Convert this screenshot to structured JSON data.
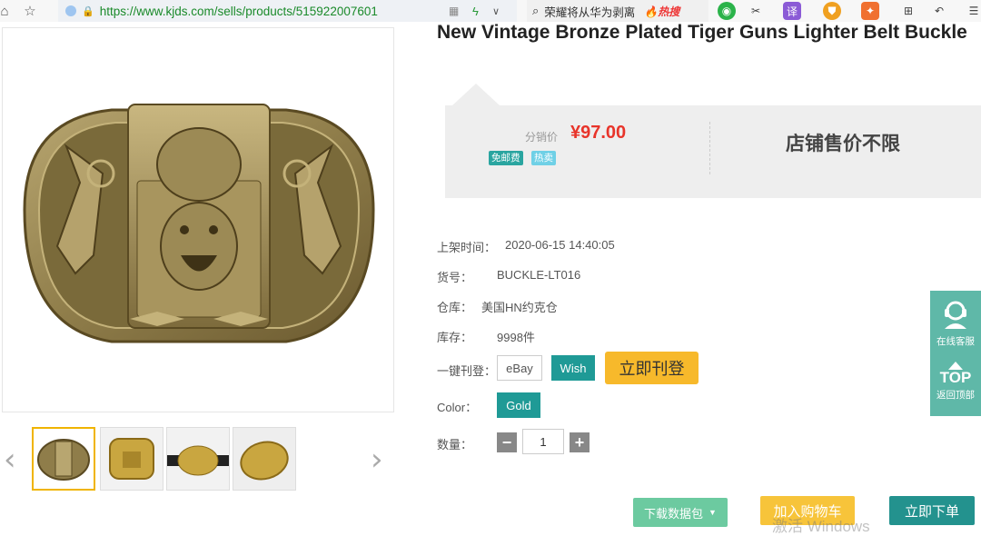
{
  "browser": {
    "url": "https://www.kjds.com/sells/products/515922007601",
    "search_text": "荣耀将从华为剥离",
    "search_hot": "🔥热搜"
  },
  "product": {
    "title": "New Vintage Bronze Plated Tiger Guns Lighter Belt Buckle",
    "price_label": "分销价",
    "price": "¥97.00",
    "badge_free": "免邮费",
    "badge_hot": "热卖",
    "store_price": "店铺售价不限"
  },
  "info": {
    "listed_label": "上架时间：",
    "listed_value": "2020-06-15 14:40:05",
    "sku_label": "货号：",
    "sku_value": "BUCKLE-LT016",
    "warehouse_label": "仓库：",
    "warehouse_value": "美国HN约克仓",
    "stock_label": "库存：",
    "stock_value": "9998件",
    "publish_label": "一键刊登：",
    "color_label": "Color：",
    "qty_label": "数量："
  },
  "buttons": {
    "ebay": "eBay",
    "wish": "Wish",
    "publish_now": "立即刊登",
    "gold": "Gold",
    "qty_minus": "−",
    "qty_plus": "+",
    "qty_value": "1",
    "download": "下载数据包",
    "add_cart": "加入购物车",
    "buy_now": "立即下单"
  },
  "side": {
    "cs_label": "在线客服",
    "top_label": "TOP",
    "top_sub": "返回顶部"
  },
  "watermark": "激活 Windows",
  "colors": {
    "teal": "#1f9a96",
    "price_red": "#e8342a",
    "yellow": "#f7b92b"
  }
}
